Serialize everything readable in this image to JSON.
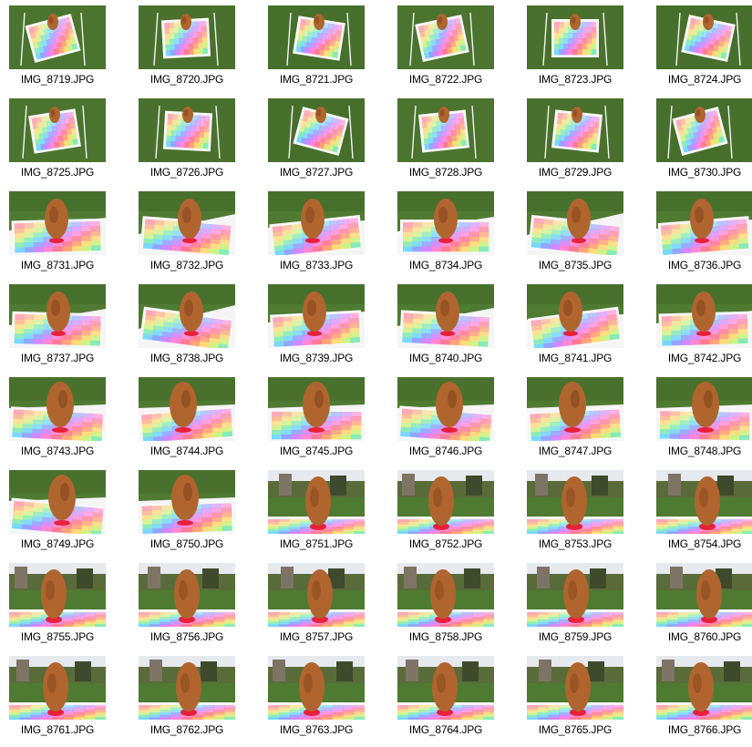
{
  "window": {
    "view": "thumbnails"
  },
  "files": [
    {
      "name": "IMG_8719.JPG",
      "scene": "table-far"
    },
    {
      "name": "IMG_8720.JPG",
      "scene": "table-far"
    },
    {
      "name": "IMG_8721.JPG",
      "scene": "table-far"
    },
    {
      "name": "IMG_8722.JPG",
      "scene": "table-far"
    },
    {
      "name": "IMG_8723.JPG",
      "scene": "table-far"
    },
    {
      "name": "IMG_8724.JPG",
      "scene": "table-far"
    },
    {
      "name": "IMG_8725.JPG",
      "scene": "table-far"
    },
    {
      "name": "IMG_8726.JPG",
      "scene": "table-far"
    },
    {
      "name": "IMG_8727.JPG",
      "scene": "table-far"
    },
    {
      "name": "IMG_8728.JPG",
      "scene": "table-far"
    },
    {
      "name": "IMG_8729.JPG",
      "scene": "table-far"
    },
    {
      "name": "IMG_8730.JPG",
      "scene": "table-far"
    },
    {
      "name": "IMG_8731.JPG",
      "scene": "rock-mid"
    },
    {
      "name": "IMG_8732.JPG",
      "scene": "rock-mid"
    },
    {
      "name": "IMG_8733.JPG",
      "scene": "rock-mid"
    },
    {
      "name": "IMG_8734.JPG",
      "scene": "rock-mid"
    },
    {
      "name": "IMG_8735.JPG",
      "scene": "rock-mid"
    },
    {
      "name": "IMG_8736.JPG",
      "scene": "rock-mid"
    },
    {
      "name": "IMG_8737.JPG",
      "scene": "rock-mid"
    },
    {
      "name": "IMG_8738.JPG",
      "scene": "rock-mid"
    },
    {
      "name": "IMG_8739.JPG",
      "scene": "rock-mid"
    },
    {
      "name": "IMG_8740.JPG",
      "scene": "rock-mid"
    },
    {
      "name": "IMG_8741.JPG",
      "scene": "rock-mid"
    },
    {
      "name": "IMG_8742.JPG",
      "scene": "rock-mid"
    },
    {
      "name": "IMG_8743.JPG",
      "scene": "rock-near"
    },
    {
      "name": "IMG_8744.JPG",
      "scene": "rock-near"
    },
    {
      "name": "IMG_8745.JPG",
      "scene": "rock-near"
    },
    {
      "name": "IMG_8746.JPG",
      "scene": "rock-near"
    },
    {
      "name": "IMG_8747.JPG",
      "scene": "rock-near"
    },
    {
      "name": "IMG_8748.JPG",
      "scene": "rock-near"
    },
    {
      "name": "IMG_8749.JPG",
      "scene": "rock-near"
    },
    {
      "name": "IMG_8750.JPG",
      "scene": "rock-near"
    },
    {
      "name": "IMG_8751.JPG",
      "scene": "rock-garden"
    },
    {
      "name": "IMG_8752.JPG",
      "scene": "rock-garden"
    },
    {
      "name": "IMG_8753.JPG",
      "scene": "rock-garden"
    },
    {
      "name": "IMG_8754.JPG",
      "scene": "rock-garden"
    },
    {
      "name": "IMG_8755.JPG",
      "scene": "rock-garden"
    },
    {
      "name": "IMG_8756.JPG",
      "scene": "rock-garden"
    },
    {
      "name": "IMG_8757.JPG",
      "scene": "rock-garden"
    },
    {
      "name": "IMG_8758.JPG",
      "scene": "rock-garden"
    },
    {
      "name": "IMG_8759.JPG",
      "scene": "rock-garden"
    },
    {
      "name": "IMG_8760.JPG",
      "scene": "rock-garden"
    },
    {
      "name": "IMG_8761.JPG",
      "scene": "rock-garden"
    },
    {
      "name": "IMG_8762.JPG",
      "scene": "rock-garden"
    },
    {
      "name": "IMG_8763.JPG",
      "scene": "rock-garden"
    },
    {
      "name": "IMG_8764.JPG",
      "scene": "rock-garden"
    },
    {
      "name": "IMG_8765.JPG",
      "scene": "rock-garden"
    },
    {
      "name": "IMG_8766.JPG",
      "scene": "rock-garden"
    }
  ],
  "colors": {
    "grass": "#4f7a32",
    "grass_dark": "#3a5e24",
    "rock": "#b0652e",
    "rock_dark": "#7a3f18",
    "stand": "#e8203a",
    "sky": "#e6e9ee",
    "label_text": "#000000"
  }
}
